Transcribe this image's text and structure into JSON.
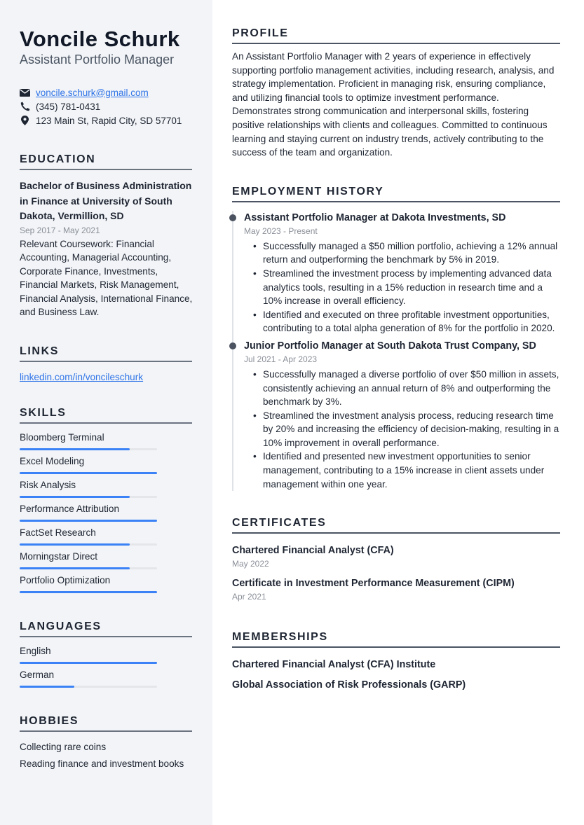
{
  "header": {
    "name": "Voncile Schurk",
    "title": "Assistant Portfolio Manager"
  },
  "contact": {
    "email": "voncile.schurk@gmail.com",
    "phone": "(345) 781-0431",
    "address": "123 Main St, Rapid City, SD 57701",
    "icons": [
      "envelope-icon",
      "phone-icon",
      "map-pin-icon"
    ]
  },
  "education": {
    "heading": "EDUCATION",
    "degree": "Bachelor of Business Administration in Finance at University of South Dakota, Vermillion, SD",
    "dates": "Sep 2017 - May 2021",
    "description": "Relevant Coursework: Financial Accounting, Managerial Accounting, Corporate Finance, Investments, Financial Markets, Risk Management, Financial Analysis, International Finance, and Business Law."
  },
  "links": {
    "heading": "LINKS",
    "items": [
      "linkedin.com/in/voncileschurk"
    ]
  },
  "skills": {
    "heading": "SKILLS",
    "items": [
      {
        "label": "Bloomberg Terminal",
        "level": 0.8
      },
      {
        "label": "Excel Modeling",
        "level": 1.0
      },
      {
        "label": "Risk Analysis",
        "level": 0.8
      },
      {
        "label": "Performance Attribution",
        "level": 1.0
      },
      {
        "label": "FactSet Research",
        "level": 0.8
      },
      {
        "label": "Morningstar Direct",
        "level": 0.8
      },
      {
        "label": "Portfolio Optimization",
        "level": 1.0
      }
    ]
  },
  "languages": {
    "heading": "LANGUAGES",
    "items": [
      {
        "label": "English",
        "level": 1.0
      },
      {
        "label": "German",
        "level": 0.4
      }
    ]
  },
  "hobbies": {
    "heading": "HOBBIES",
    "items": [
      "Collecting rare coins",
      "Reading finance and investment books"
    ]
  },
  "profile": {
    "heading": "PROFILE",
    "text": "An Assistant Portfolio Manager with 2 years of experience in effectively supporting portfolio management activities, including research, analysis, and strategy implementation. Proficient in managing risk, ensuring compliance, and utilizing financial tools to optimize investment performance. Demonstrates strong communication and interpersonal skills, fostering positive relationships with clients and colleagues. Committed to continuous learning and staying current on industry trends, actively contributing to the success of the team and organization."
  },
  "employment": {
    "heading": "EMPLOYMENT HISTORY",
    "jobs": [
      {
        "title": "Assistant Portfolio Manager at Dakota Investments, SD",
        "dates": "May 2023 - Present",
        "bullets": [
          "Successfully managed a $50 million portfolio, achieving a 12% annual return and outperforming the benchmark by 5% in 2019.",
          "Streamlined the investment process by implementing advanced data analytics tools, resulting in a 15% reduction in research time and a 10% increase in overall efficiency.",
          "Identified and executed on three profitable investment opportunities, contributing to a total alpha generation of 8% for the portfolio in 2020."
        ]
      },
      {
        "title": "Junior Portfolio Manager at South Dakota Trust Company, SD",
        "dates": "Jul 2021 - Apr 2023",
        "bullets": [
          "Successfully managed a diverse portfolio of over $50 million in assets, consistently achieving an annual return of 8% and outperforming the benchmark by 3%.",
          "Streamlined the investment analysis process, reducing research time by 20% and increasing the efficiency of decision-making, resulting in a 10% improvement in overall performance.",
          "Identified and presented new investment opportunities to senior management, contributing to a 15% increase in client assets under management within one year."
        ]
      }
    ]
  },
  "certificates": {
    "heading": "CERTIFICATES",
    "items": [
      {
        "name": "Chartered Financial Analyst (CFA)",
        "date": "May 2022"
      },
      {
        "name": "Certificate in Investment Performance Measurement (CIPM)",
        "date": "Apr 2021"
      }
    ]
  },
  "memberships": {
    "heading": "MEMBERSHIPS",
    "items": [
      "Chartered Financial Analyst (CFA) Institute",
      "Global Association of Risk Professionals (GARP)"
    ]
  },
  "colors": {
    "accent": "#3b82f6",
    "link": "#2f74e8",
    "sidebar_bg": "#f2f4f7",
    "text": "#1e2532",
    "muted": "#8a8f98"
  }
}
